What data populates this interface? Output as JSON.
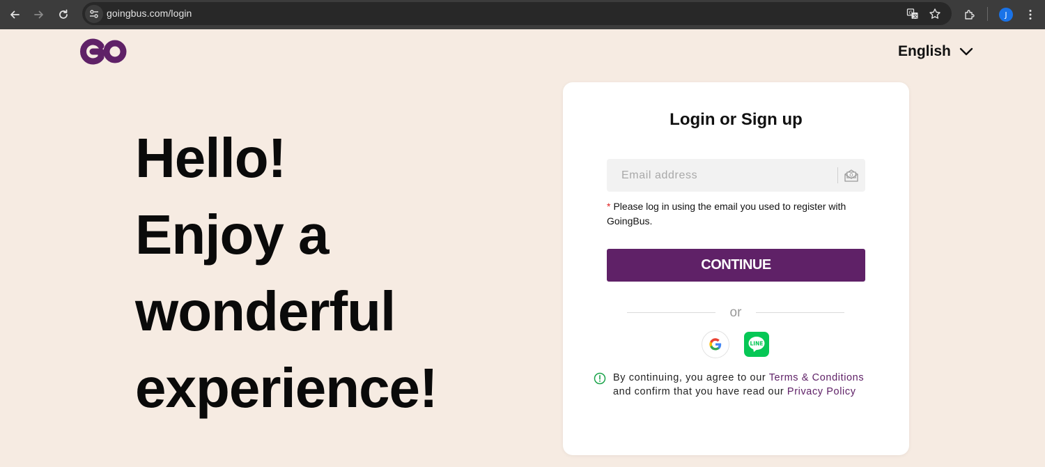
{
  "browser": {
    "url": "goingbus.com/login",
    "profile_initial": "J"
  },
  "header": {
    "logo_text": "GO",
    "language": "English"
  },
  "hero": {
    "lines": [
      "Hello!",
      "Enjoy a",
      "wonderful",
      "experience!"
    ]
  },
  "login": {
    "title": "Login or Sign up",
    "email_placeholder": "Email address",
    "email_value": "",
    "note_asterisk": "*",
    "note_line1": "Please log in using the email you used to register with",
    "note_line2": "GoingBus.",
    "continue_label": "CONTINUE",
    "or_label": "or",
    "social": [
      "google-icon",
      "line-icon"
    ],
    "line_label": "LINE",
    "terms_prefix": "By continuing, you agree to our ",
    "terms_link": "Terms & Conditions",
    "terms_middle": "and confirm that you have read our ",
    "privacy_link": "Privacy Policy"
  },
  "colors": {
    "brand": "#5f2167",
    "page_bg": "#f6ebe2",
    "line_green": "#06c755",
    "info_green": "#1aa34a"
  }
}
